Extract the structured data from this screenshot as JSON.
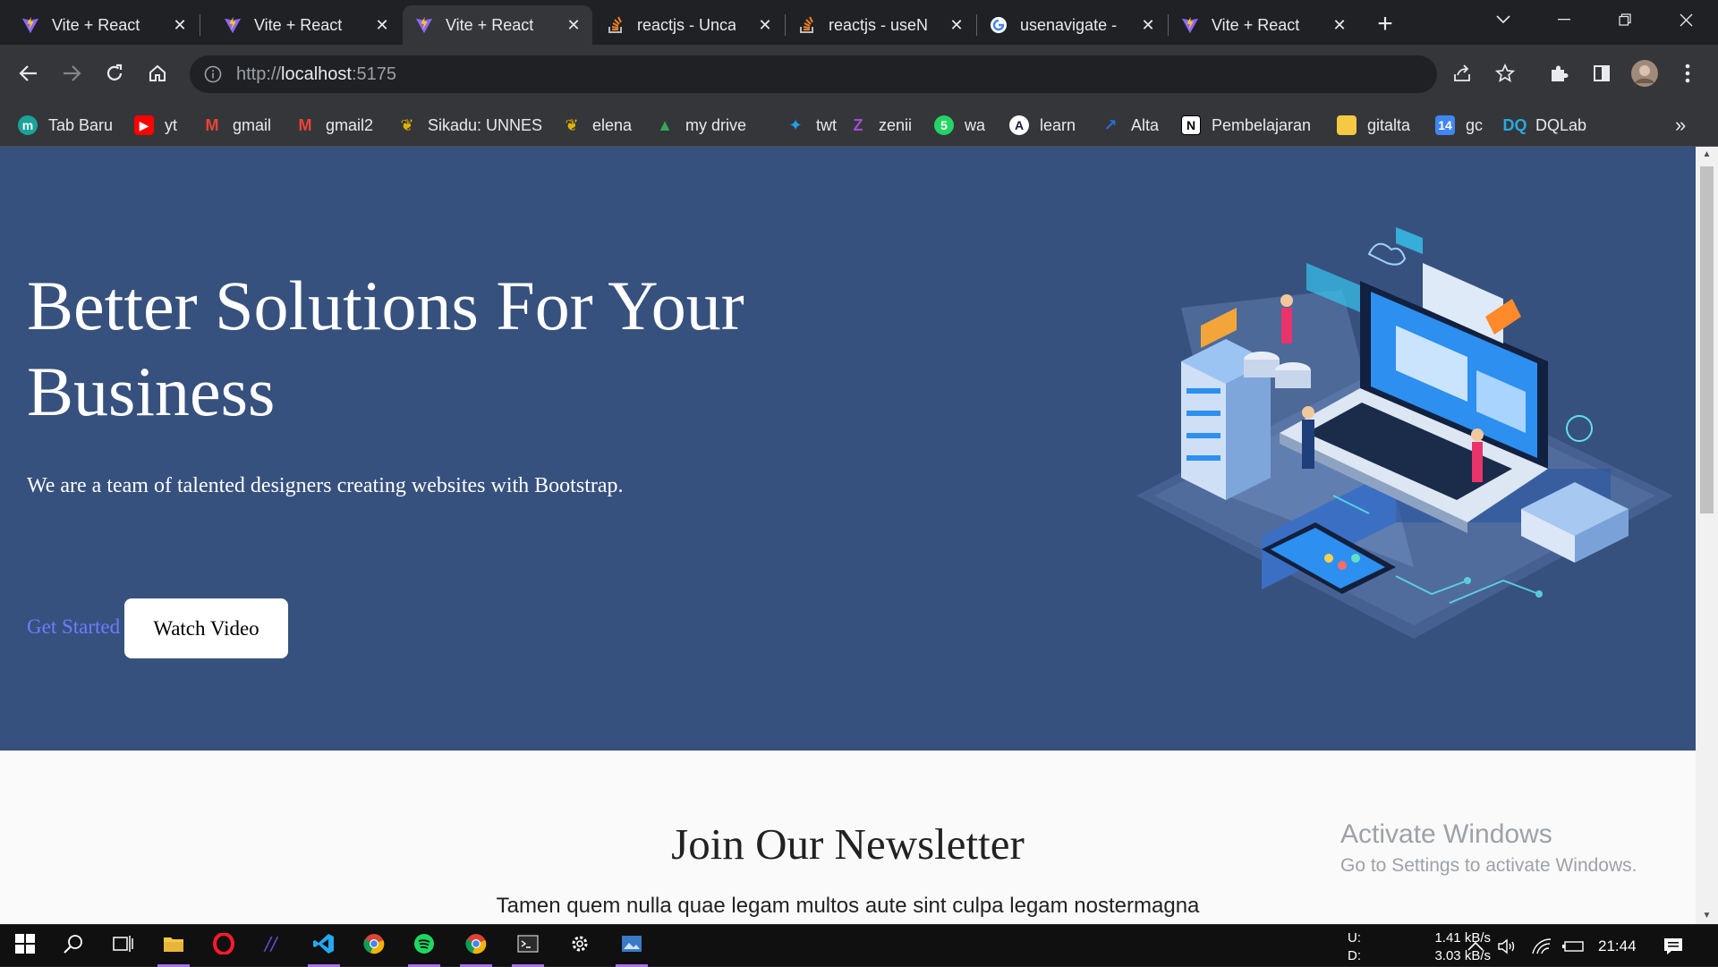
{
  "tabs": [
    {
      "label": "Vite + React",
      "icon": "vite-icon",
      "active": false
    },
    {
      "label": "Vite + React",
      "icon": "vite-icon",
      "active": false
    },
    {
      "label": "Vite + React",
      "icon": "vite-icon",
      "active": true
    },
    {
      "label": "reactjs - Uncau",
      "icon": "stackoverflow-icon",
      "active": false
    },
    {
      "label": "reactjs - useNa",
      "icon": "stackoverflow-icon",
      "active": false
    },
    {
      "label": "usenavigate -",
      "icon": "google-icon",
      "active": false
    },
    {
      "label": "Vite + React",
      "icon": "vite-icon",
      "active": false
    }
  ],
  "address": {
    "scheme": "http://",
    "host": "localhost",
    "port": ":5175"
  },
  "bookmarks": [
    {
      "label": "Tab Baru",
      "icon": "tab-baru-icon",
      "color": "#1aa39a"
    },
    {
      "label": "yt",
      "icon": "youtube-icon",
      "color": "#ff0000"
    },
    {
      "label": "gmail",
      "icon": "gmail-icon",
      "color": "#ea4335"
    },
    {
      "label": "gmail2",
      "icon": "gmail-icon",
      "color": "#ea4335"
    },
    {
      "label": "Sikadu: UNNES",
      "icon": "unnes-icon",
      "color": "#e0b000"
    },
    {
      "label": "elena",
      "icon": "unnes-icon",
      "color": "#e0b000"
    },
    {
      "label": "my drive",
      "icon": "google-drive-icon",
      "color": "#34a853"
    },
    {
      "label": "twt",
      "icon": "twitter-icon",
      "color": "#1da1f2"
    },
    {
      "label": "zenii",
      "icon": "zenius-icon",
      "color": "#a24bd6"
    },
    {
      "label": "wa",
      "icon": "whatsapp-icon",
      "color": "#25d366"
    },
    {
      "label": "learn",
      "icon": "learn-icon",
      "color": "#1b1c3a"
    },
    {
      "label": "Alta",
      "icon": "alta-icon",
      "color": "#2d6bd8"
    },
    {
      "label": "Pembelajaran",
      "icon": "notion-icon",
      "color": "#ffffff"
    },
    {
      "label": "gitalta",
      "icon": "folder-icon",
      "color": "#f6c945"
    },
    {
      "label": "gc",
      "icon": "calendar-icon",
      "color": "#4285f4"
    },
    {
      "label": "DQLab",
      "icon": "dqlab-icon",
      "color": "#2aa8e0"
    }
  ],
  "hero": {
    "title": "Better Solutions For Your Business",
    "subtitle": "We are a team of talented designers creating websites with Bootstrap.",
    "cta_primary": "Get Started",
    "cta_secondary": "Watch Video"
  },
  "newsletter": {
    "title": "Join Our Newsletter",
    "text": "Tamen quem nulla quae legam multos aute sint culpa legam nostermagna"
  },
  "watermark": {
    "line1": "Activate Windows",
    "line2": "Go to Settings to activate Windows."
  },
  "taskbar": {
    "apps": [
      "windows-start-icon",
      "search-icon",
      "task-view-icon",
      "file-explorer-icon",
      "opera-icon",
      "visual-studio-icon",
      "vscode-icon",
      "chrome-icon",
      "spotify-icon",
      "chrome-icon",
      "terminal-icon",
      "settings-icon",
      "photos-icon"
    ],
    "net_up_label": "U:",
    "net_down_label": "D:",
    "net_up": "1.41 kB/s",
    "net_down": "3.03 kB/s",
    "time": "21:44"
  },
  "colors": {
    "hero_bg": "#37517e",
    "link": "#6f7bff",
    "chrome_dark": "#202124",
    "chrome_toolbar": "#35363a"
  }
}
